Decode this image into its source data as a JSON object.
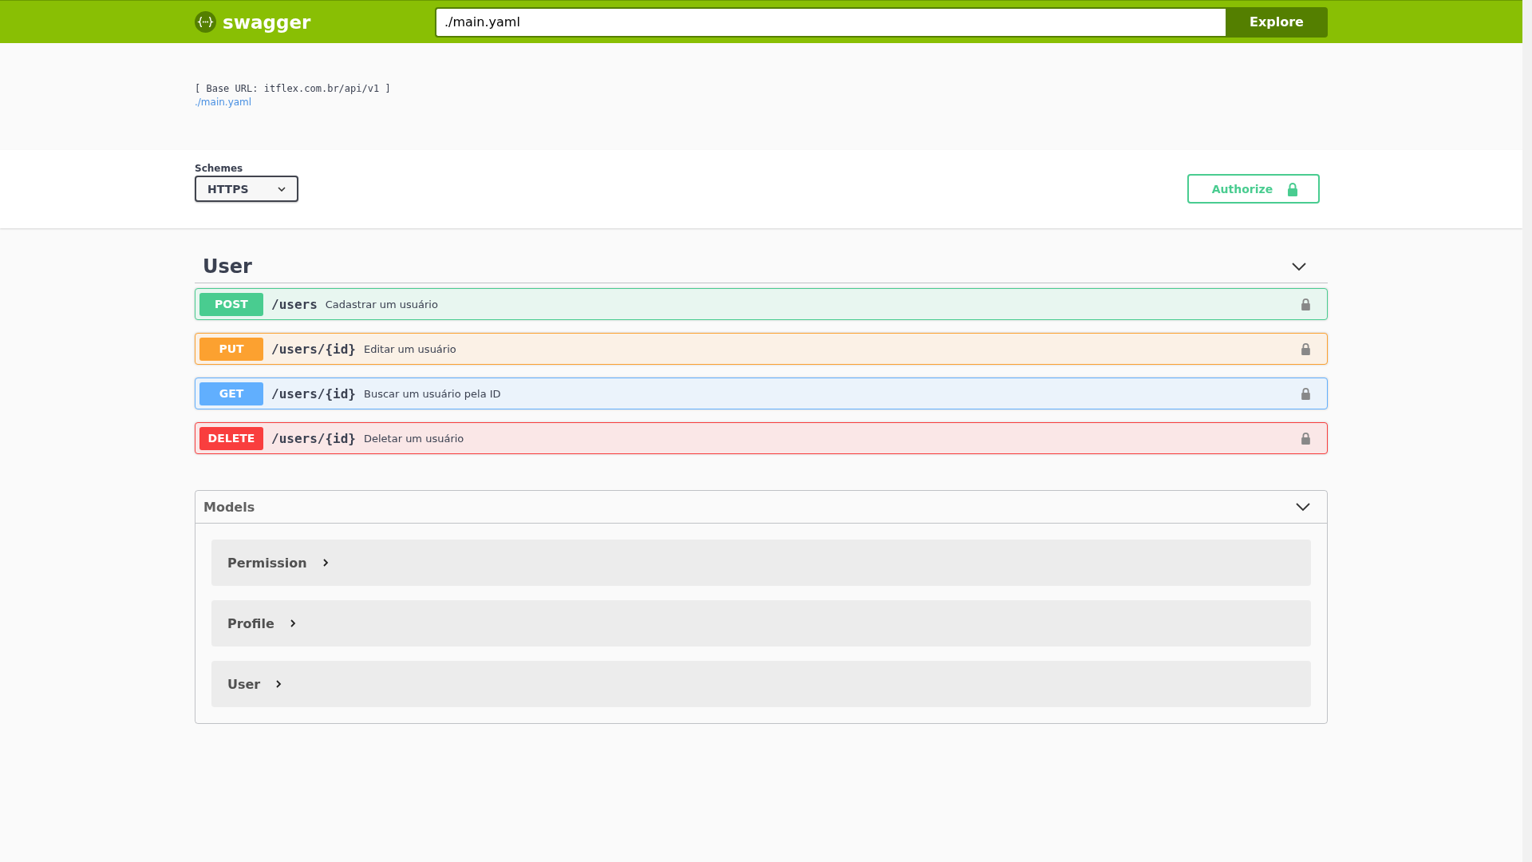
{
  "topbar": {
    "brand": "swagger",
    "url_field": {
      "value": "./main.yaml"
    },
    "explore_button": "Explore"
  },
  "info": {
    "base_url": "[ Base URL: itflex.com.br/api/v1 ]",
    "spec_link": "./main.yaml"
  },
  "schemes": {
    "label": "Schemes",
    "selected_value": "HTTPS"
  },
  "authorize_button": "Authorize",
  "tag": {
    "name": "User",
    "expanded": true,
    "operations": [
      {
        "kind": "post",
        "method": "POST",
        "path": "/users",
        "summary": "Cadastrar um usuário",
        "locked": true
      },
      {
        "kind": "put",
        "method": "PUT",
        "path": "/users/{id}",
        "summary": "Editar um usuário",
        "locked": true
      },
      {
        "kind": "get",
        "method": "GET",
        "path": "/users/{id}",
        "summary": "Buscar um usuário pela ID",
        "locked": true
      },
      {
        "kind": "delete",
        "method": "DELETE",
        "path": "/users/{id}",
        "summary": "Deletar um usuário",
        "locked": true
      }
    ]
  },
  "models": {
    "title": "Models",
    "expanded": true,
    "items": [
      {
        "name": "Permission",
        "expanded": false
      },
      {
        "name": "Profile",
        "expanded": false
      },
      {
        "name": "User",
        "expanded": false
      }
    ]
  }
}
